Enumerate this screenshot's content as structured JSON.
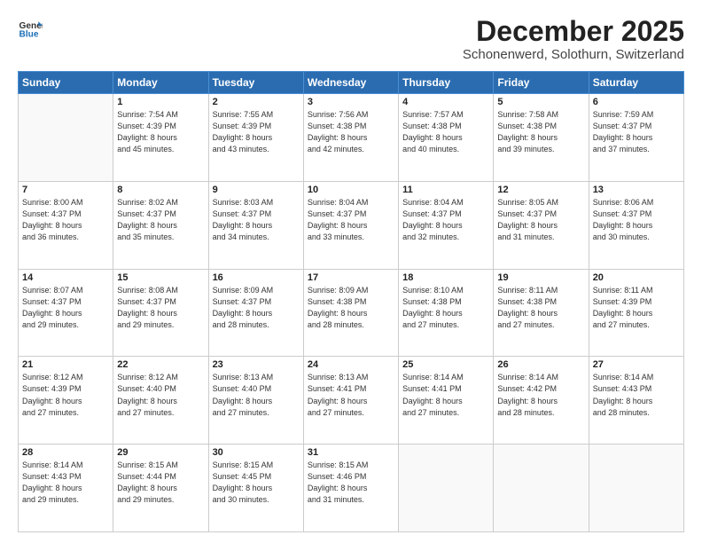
{
  "header": {
    "logo_line1": "General",
    "logo_line2": "Blue",
    "month": "December 2025",
    "location": "Schonenwerd, Solothurn, Switzerland"
  },
  "weekdays": [
    "Sunday",
    "Monday",
    "Tuesday",
    "Wednesday",
    "Thursday",
    "Friday",
    "Saturday"
  ],
  "weeks": [
    [
      {
        "day": "",
        "info": ""
      },
      {
        "day": "1",
        "info": "Sunrise: 7:54 AM\nSunset: 4:39 PM\nDaylight: 8 hours\nand 45 minutes."
      },
      {
        "day": "2",
        "info": "Sunrise: 7:55 AM\nSunset: 4:39 PM\nDaylight: 8 hours\nand 43 minutes."
      },
      {
        "day": "3",
        "info": "Sunrise: 7:56 AM\nSunset: 4:38 PM\nDaylight: 8 hours\nand 42 minutes."
      },
      {
        "day": "4",
        "info": "Sunrise: 7:57 AM\nSunset: 4:38 PM\nDaylight: 8 hours\nand 40 minutes."
      },
      {
        "day": "5",
        "info": "Sunrise: 7:58 AM\nSunset: 4:38 PM\nDaylight: 8 hours\nand 39 minutes."
      },
      {
        "day": "6",
        "info": "Sunrise: 7:59 AM\nSunset: 4:37 PM\nDaylight: 8 hours\nand 37 minutes."
      }
    ],
    [
      {
        "day": "7",
        "info": "Sunrise: 8:00 AM\nSunset: 4:37 PM\nDaylight: 8 hours\nand 36 minutes."
      },
      {
        "day": "8",
        "info": "Sunrise: 8:02 AM\nSunset: 4:37 PM\nDaylight: 8 hours\nand 35 minutes."
      },
      {
        "day": "9",
        "info": "Sunrise: 8:03 AM\nSunset: 4:37 PM\nDaylight: 8 hours\nand 34 minutes."
      },
      {
        "day": "10",
        "info": "Sunrise: 8:04 AM\nSunset: 4:37 PM\nDaylight: 8 hours\nand 33 minutes."
      },
      {
        "day": "11",
        "info": "Sunrise: 8:04 AM\nSunset: 4:37 PM\nDaylight: 8 hours\nand 32 minutes."
      },
      {
        "day": "12",
        "info": "Sunrise: 8:05 AM\nSunset: 4:37 PM\nDaylight: 8 hours\nand 31 minutes."
      },
      {
        "day": "13",
        "info": "Sunrise: 8:06 AM\nSunset: 4:37 PM\nDaylight: 8 hours\nand 30 minutes."
      }
    ],
    [
      {
        "day": "14",
        "info": "Sunrise: 8:07 AM\nSunset: 4:37 PM\nDaylight: 8 hours\nand 29 minutes."
      },
      {
        "day": "15",
        "info": "Sunrise: 8:08 AM\nSunset: 4:37 PM\nDaylight: 8 hours\nand 29 minutes."
      },
      {
        "day": "16",
        "info": "Sunrise: 8:09 AM\nSunset: 4:37 PM\nDaylight: 8 hours\nand 28 minutes."
      },
      {
        "day": "17",
        "info": "Sunrise: 8:09 AM\nSunset: 4:38 PM\nDaylight: 8 hours\nand 28 minutes."
      },
      {
        "day": "18",
        "info": "Sunrise: 8:10 AM\nSunset: 4:38 PM\nDaylight: 8 hours\nand 27 minutes."
      },
      {
        "day": "19",
        "info": "Sunrise: 8:11 AM\nSunset: 4:38 PM\nDaylight: 8 hours\nand 27 minutes."
      },
      {
        "day": "20",
        "info": "Sunrise: 8:11 AM\nSunset: 4:39 PM\nDaylight: 8 hours\nand 27 minutes."
      }
    ],
    [
      {
        "day": "21",
        "info": "Sunrise: 8:12 AM\nSunset: 4:39 PM\nDaylight: 8 hours\nand 27 minutes."
      },
      {
        "day": "22",
        "info": "Sunrise: 8:12 AM\nSunset: 4:40 PM\nDaylight: 8 hours\nand 27 minutes."
      },
      {
        "day": "23",
        "info": "Sunrise: 8:13 AM\nSunset: 4:40 PM\nDaylight: 8 hours\nand 27 minutes."
      },
      {
        "day": "24",
        "info": "Sunrise: 8:13 AM\nSunset: 4:41 PM\nDaylight: 8 hours\nand 27 minutes."
      },
      {
        "day": "25",
        "info": "Sunrise: 8:14 AM\nSunset: 4:41 PM\nDaylight: 8 hours\nand 27 minutes."
      },
      {
        "day": "26",
        "info": "Sunrise: 8:14 AM\nSunset: 4:42 PM\nDaylight: 8 hours\nand 28 minutes."
      },
      {
        "day": "27",
        "info": "Sunrise: 8:14 AM\nSunset: 4:43 PM\nDaylight: 8 hours\nand 28 minutes."
      }
    ],
    [
      {
        "day": "28",
        "info": "Sunrise: 8:14 AM\nSunset: 4:43 PM\nDaylight: 8 hours\nand 29 minutes."
      },
      {
        "day": "29",
        "info": "Sunrise: 8:15 AM\nSunset: 4:44 PM\nDaylight: 8 hours\nand 29 minutes."
      },
      {
        "day": "30",
        "info": "Sunrise: 8:15 AM\nSunset: 4:45 PM\nDaylight: 8 hours\nand 30 minutes."
      },
      {
        "day": "31",
        "info": "Sunrise: 8:15 AM\nSunset: 4:46 PM\nDaylight: 8 hours\nand 31 minutes."
      },
      {
        "day": "",
        "info": ""
      },
      {
        "day": "",
        "info": ""
      },
      {
        "day": "",
        "info": ""
      }
    ]
  ]
}
